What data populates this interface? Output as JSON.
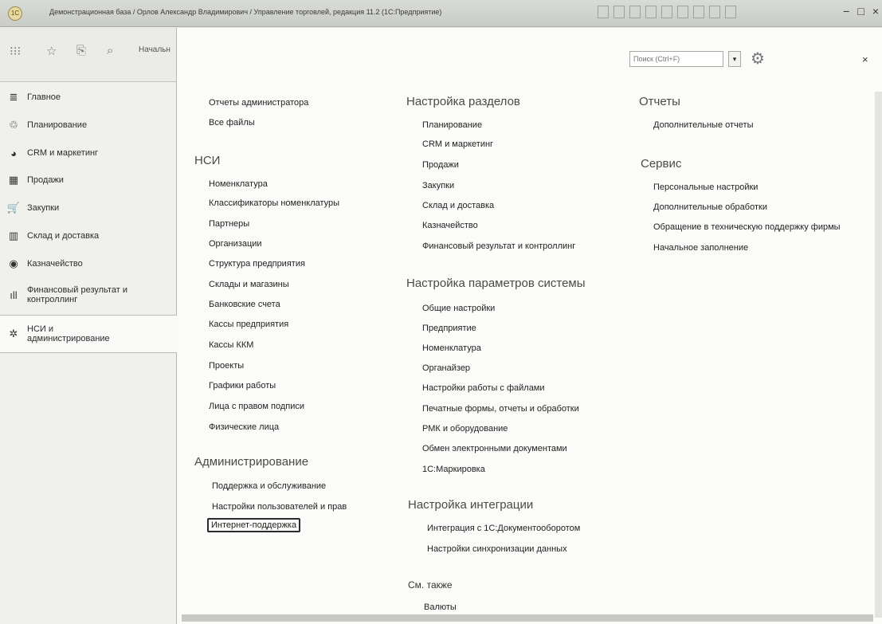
{
  "window": {
    "title": "Демонстрационная база / Орлов Александр Владимирович / Управление торговлей, редакция 11.2 (1С:Предприятие)",
    "logo": "1С",
    "controls": [
      "−",
      "□",
      "×"
    ]
  },
  "sidebar": {
    "start_label": "Начальн",
    "items": [
      {
        "label": "Главное",
        "icon": "≣"
      },
      {
        "label": "Планирование",
        "icon": "♲"
      },
      {
        "label": "CRM и маркетинг",
        "icon": "◕"
      },
      {
        "label": "Продажи",
        "icon": "▦"
      },
      {
        "label": "Закупки",
        "icon": "🛒"
      },
      {
        "label": "Склад и доставка",
        "icon": "▥"
      },
      {
        "label": "Казначейство",
        "icon": "◉"
      },
      {
        "label": "Финансовый результат и контроллинг",
        "icon": "ıll"
      },
      {
        "label": "НСИ и администрирование",
        "icon": "✲"
      }
    ]
  },
  "search": {
    "placeholder": "Поиск (Ctrl+F)"
  },
  "col1": {
    "top_links": [
      "Отчеты администратора",
      "Все файлы"
    ],
    "nsi_title": "НСИ",
    "nsi_links": [
      "Номенклатура",
      "Классификаторы номенклатуры",
      "Партнеры",
      "Организации",
      "Структура предприятия",
      "Склады и магазины",
      "Банковские счета",
      "Кассы предприятия",
      "Кассы ККМ",
      "Проекты",
      "Графики работы",
      "Лица с правом подписи",
      "Физические лица"
    ],
    "admin_title": "Администрирование",
    "admin_links": [
      "Поддержка и обслуживание",
      "Настройки пользователей и прав",
      "Интернет-поддержка"
    ]
  },
  "col2": {
    "sections_title": "Настройка разделов",
    "sections_links": [
      "Планирование",
      "CRM и маркетинг",
      "Продажи",
      "Закупки",
      "Склад и доставка",
      "Казначейство",
      "Финансовый результат и контроллинг"
    ],
    "params_title": "Настройка параметров системы",
    "params_links": [
      "Общие настройки",
      "Предприятие",
      "Номенклатура",
      "Органайзер",
      "Настройки работы с файлами",
      "Печатные формы, отчеты и обработки",
      "РМК и оборудование",
      "Обмен электронными документами",
      "1С:Маркировка"
    ],
    "integration_title": "Настройка интеграции",
    "integration_links": [
      "Интеграция с 1С:Документооборотом",
      "Настройки синхронизации данных"
    ],
    "see_also_title": "См. также",
    "see_also_links": [
      "Валюты"
    ]
  },
  "col3": {
    "reports_title": "Отчеты",
    "reports_links": [
      "Дополнительные отчеты"
    ],
    "service_title": "Сервис",
    "service_links": [
      "Персональные настройки",
      "Дополнительные обработки",
      "Обращение в техническую поддержку фирмы",
      "Начальное заполнение"
    ]
  }
}
